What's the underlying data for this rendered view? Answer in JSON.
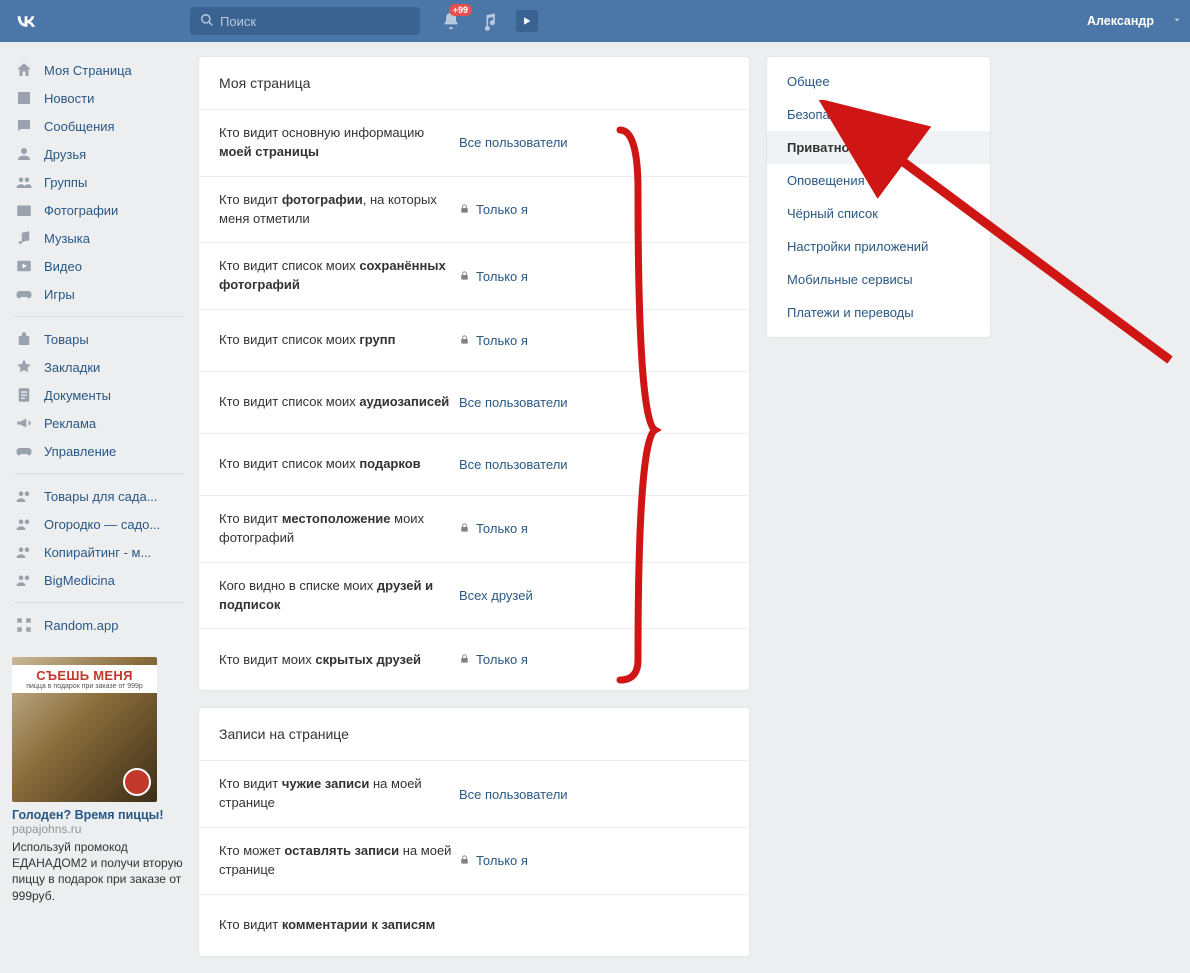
{
  "header": {
    "search_placeholder": "Поиск",
    "notif_badge": "+99",
    "username": "Александр"
  },
  "sidebar": {
    "items": [
      {
        "icon": "home",
        "label": "Моя Страница"
      },
      {
        "icon": "news",
        "label": "Новости"
      },
      {
        "icon": "msg",
        "label": "Сообщения"
      },
      {
        "icon": "friends",
        "label": "Друзья"
      },
      {
        "icon": "groups",
        "label": "Группы"
      },
      {
        "icon": "photo",
        "label": "Фотографии"
      },
      {
        "icon": "music",
        "label": "Музыка"
      },
      {
        "icon": "video",
        "label": "Видео"
      },
      {
        "icon": "games",
        "label": "Игры"
      }
    ],
    "items2": [
      {
        "icon": "goods",
        "label": "Товары"
      },
      {
        "icon": "bookmark",
        "label": "Закладки"
      },
      {
        "icon": "docs",
        "label": "Документы"
      },
      {
        "icon": "ads",
        "label": "Реклама"
      },
      {
        "icon": "manage",
        "label": "Управление"
      }
    ],
    "items3": [
      {
        "icon": "group",
        "label": "Товары для сада..."
      },
      {
        "icon": "group",
        "label": "Огородко — садо..."
      },
      {
        "icon": "group",
        "label": "Копирайтинг - м..."
      },
      {
        "icon": "group",
        "label": "BigMedicina"
      }
    ],
    "items4": [
      {
        "icon": "app",
        "label": "Random.app"
      }
    ]
  },
  "ad": {
    "banner": "СЪЕШЬ МЕНЯ",
    "banner_sub": "пицца в подарок при заказе от 999р",
    "title": "Голоден? Время пиццы!",
    "domain": "papajohns.ru",
    "text": "Используй промокод ЕДАНАДОМ2 и получи вторую пиццу в подарок при заказе от 999руб."
  },
  "sections": [
    {
      "title": "Моя страница",
      "rows": [
        {
          "label_pre": "Кто видит основную информацию ",
          "label_bold": "моей страницы",
          "value": "Все пользователи",
          "lock": false
        },
        {
          "label_pre": "Кто видит ",
          "label_bold": "фотографии",
          "label_post": ", на которых меня отметили",
          "value": "Только я",
          "lock": true
        },
        {
          "label_pre": "Кто видит список моих ",
          "label_bold": "сохранённых фотографий",
          "value": "Только я",
          "lock": true
        },
        {
          "label_pre": "Кто видит список моих ",
          "label_bold": "групп",
          "value": "Только я",
          "lock": true
        },
        {
          "label_pre": "Кто видит список моих ",
          "label_bold": "аудиозаписей",
          "value": "Все пользователи",
          "lock": false
        },
        {
          "label_pre": "Кто видит список моих ",
          "label_bold": "подарков",
          "value": "Все пользователи",
          "lock": false
        },
        {
          "label_pre": "Кто видит ",
          "label_bold": "местоположение",
          "label_post": " моих фотографий",
          "value": "Только я",
          "lock": true
        },
        {
          "label_pre": "Кого видно в списке моих ",
          "label_bold": "друзей и подписок",
          "value": "Всех друзей",
          "lock": false
        },
        {
          "label_pre": "Кто видит моих ",
          "label_bold": "скрытых друзей",
          "value": "Только я",
          "lock": true
        }
      ]
    },
    {
      "title": "Записи на странице",
      "rows": [
        {
          "label_pre": "Кто видит ",
          "label_bold": "чужие записи",
          "label_post": " на моей странице",
          "value": "Все пользователи",
          "lock": false
        },
        {
          "label_pre": "Кто может ",
          "label_bold": "оставлять записи",
          "label_post": " на моей странице",
          "value": "Только я",
          "lock": true
        },
        {
          "label_pre": "Кто видит ",
          "label_bold": "комментарии к записям",
          "value": "",
          "lock": false
        }
      ]
    }
  ],
  "tabs": [
    {
      "label": "Общее"
    },
    {
      "label": "Безопасность"
    },
    {
      "label": "Приватность",
      "active": true
    },
    {
      "label": "Оповещения"
    },
    {
      "label": "Чёрный список"
    },
    {
      "label": "Настройки приложений"
    },
    {
      "label": "Мобильные сервисы"
    },
    {
      "label": "Платежи и переводы"
    }
  ]
}
